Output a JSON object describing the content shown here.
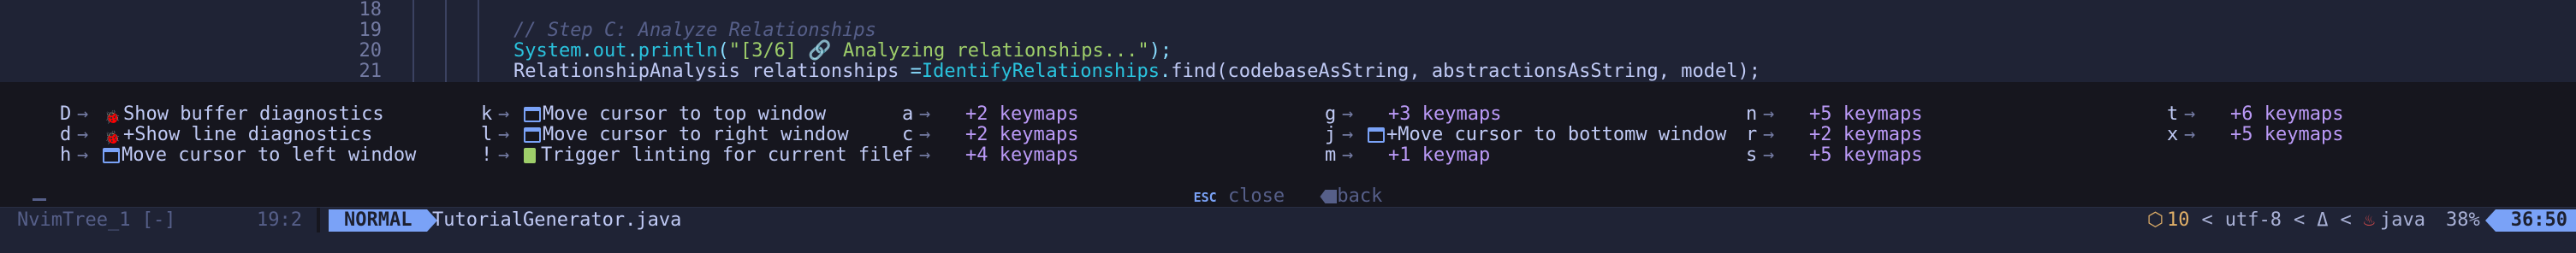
{
  "editor": {
    "lines": [
      {
        "num": "18",
        "segments": []
      },
      {
        "num": "19",
        "segments": [
          {
            "cls": "comment",
            "text": "// Step C: Analyze Relationships"
          }
        ]
      },
      {
        "num": "20",
        "segments": [
          {
            "cls": "cls",
            "text": "System"
          },
          {
            "cls": "punc",
            "text": "."
          },
          {
            "cls": "cls",
            "text": "out"
          },
          {
            "cls": "punc",
            "text": "."
          },
          {
            "cls": "cls",
            "text": "println"
          },
          {
            "cls": "punc",
            "text": "("
          },
          {
            "cls": "str",
            "text": "\"[3/6] 🔗 Analyzing relationships...\""
          },
          {
            "cls": "punc",
            "text": ");"
          }
        ]
      },
      {
        "num": "21",
        "segments": [
          {
            "cls": "plain",
            "text": "RelationshipAnalysis relationships "
          },
          {
            "cls": "punc",
            "text": "="
          },
          {
            "cls": "cls",
            "text": "IdentifyRelationships"
          },
          {
            "cls": "punc",
            "text": "."
          },
          {
            "cls": "plain",
            "text": "find(codebaseAsString, abstractionsAsString, model);"
          }
        ]
      }
    ]
  },
  "whichkey": {
    "columns": [
      [
        {
          "key": "D",
          "icon": "bug-icon",
          "desc": "Show buffer diagnostics",
          "group": false
        },
        {
          "key": "d",
          "icon": "bug-icon",
          "desc": "+Show line diagnostics",
          "group": false
        },
        {
          "key": "h",
          "icon": "window-icon",
          "desc": "Move cursor to left window",
          "group": false
        }
      ],
      [
        {
          "key": "k",
          "icon": "window-icon",
          "desc": "Move cursor to top window",
          "group": false
        },
        {
          "key": "l",
          "icon": "window-icon",
          "desc": "Move cursor to right window",
          "group": false
        },
        {
          "key": "!",
          "icon": "file-icon",
          "desc": "Trigger linting for current file",
          "group": false
        }
      ],
      [
        {
          "key": "a",
          "icon": "",
          "desc": "+2 keymaps",
          "group": true
        },
        {
          "key": "c",
          "icon": "",
          "desc": "+2 keymaps",
          "group": true
        },
        {
          "key": "f",
          "icon": "",
          "desc": "+4 keymaps",
          "group": true
        }
      ],
      [
        {
          "key": "g",
          "icon": "",
          "desc": "+3 keymaps",
          "group": true
        },
        {
          "key": "j",
          "icon": "window-icon",
          "desc": "+Move cursor to bottomw window",
          "group": false
        },
        {
          "key": "m",
          "icon": "",
          "desc": "+1 keymap",
          "group": true
        }
      ],
      [
        {
          "key": "n",
          "icon": "",
          "desc": "+5 keymaps",
          "group": true
        },
        {
          "key": "r",
          "icon": "",
          "desc": "+2 keymaps",
          "group": true
        },
        {
          "key": "s",
          "icon": "",
          "desc": "+5 keymaps",
          "group": true
        }
      ],
      [
        {
          "key": "t",
          "icon": "",
          "desc": "+6 keymaps",
          "group": true
        },
        {
          "key": "x",
          "icon": "",
          "desc": "+5 keymaps",
          "group": true
        }
      ]
    ],
    "arrow": "→",
    "footer": {
      "esc_badge": "ESC",
      "close_label": "close",
      "back_label": "back"
    }
  },
  "statusline": {
    "tree_name": "NvimTree_1 [-]",
    "cursor_pos": "19:2",
    "mode": "NORMAL",
    "filename": "TutorialGenerator.java",
    "warn_count": "10",
    "encoding": "utf-8",
    "filetype": "java",
    "percent": "38%",
    "clock": "36:50",
    "chevron": "<"
  },
  "colors": {
    "background": "#1f2335",
    "whichkey_bg": "#16161e",
    "accent": "#7aa2f7",
    "group": "#bb9af7",
    "comment": "#565f89",
    "string": "#9ece6a",
    "class": "#2ac3de"
  }
}
